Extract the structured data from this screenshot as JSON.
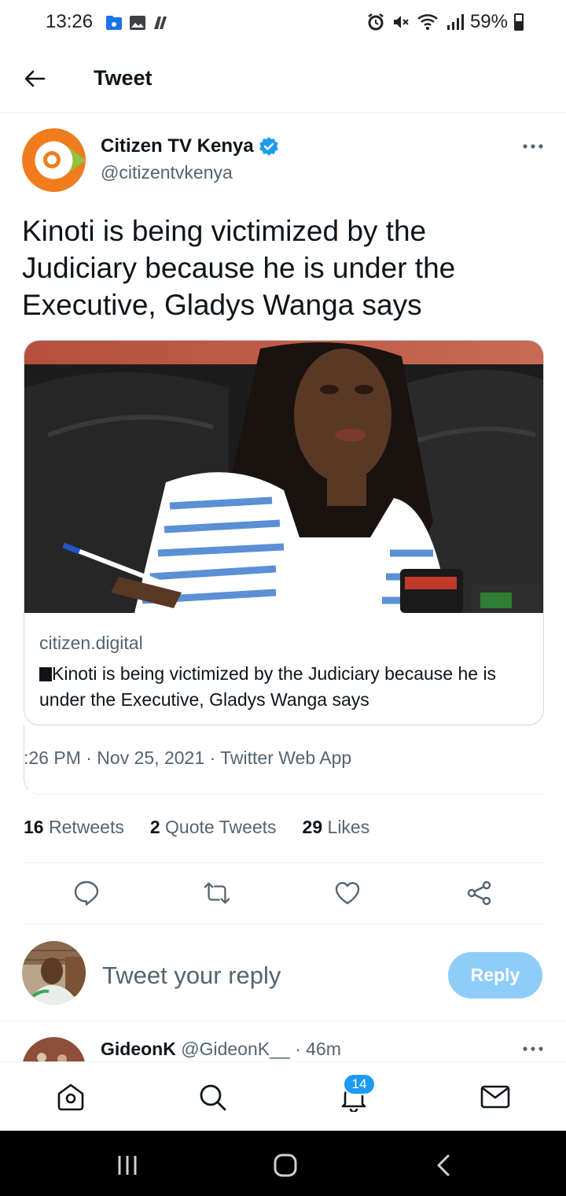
{
  "status_bar": {
    "time": "13:26",
    "battery": "59%",
    "left_icons": [
      "folder-icon",
      "gallery-icon",
      "news-icon"
    ],
    "right_icons": [
      "alarm-icon",
      "mute-icon",
      "wifi-icon",
      "signal-icon",
      "battery-icon"
    ]
  },
  "header": {
    "title": "Tweet",
    "back_icon": "back-arrow-icon"
  },
  "tweet": {
    "author_name": "Citizen TV Kenya",
    "author_handle": "@citizentvkenya",
    "verified": true,
    "text": "Kinoti is being victimized by the Judiciary because he is under the Executive, Gladys Wanga says",
    "card": {
      "domain": "citizen.digital",
      "title": "Kinoti is being victimized by the Judiciary because he is under the Executive, Gladys Wanga says"
    },
    "meta": ":26 PM · Nov 25, 2021 · Twitter Web App",
    "stats": {
      "retweets_count": "16",
      "retweets_label": "Retweets",
      "quotes_count": "2",
      "quotes_label": "Quote Tweets",
      "likes_count": "29",
      "likes_label": "Likes"
    },
    "actions": [
      "reply-icon",
      "retweet-icon",
      "like-icon",
      "share-icon"
    ]
  },
  "reply_composer": {
    "placeholder": "Tweet your reply",
    "button_label": "Reply"
  },
  "next_reply": {
    "name": "GideonK",
    "handle": "@GideonK__",
    "time": "· 46m"
  },
  "bottom_nav": {
    "items": [
      "home-icon",
      "search-icon",
      "notifications-icon",
      "messages-icon"
    ],
    "notification_badge": "14"
  },
  "colors": {
    "accent": "#1d9bf0",
    "reply_button": "#8ecdf8",
    "secondary_text": "#536471"
  }
}
